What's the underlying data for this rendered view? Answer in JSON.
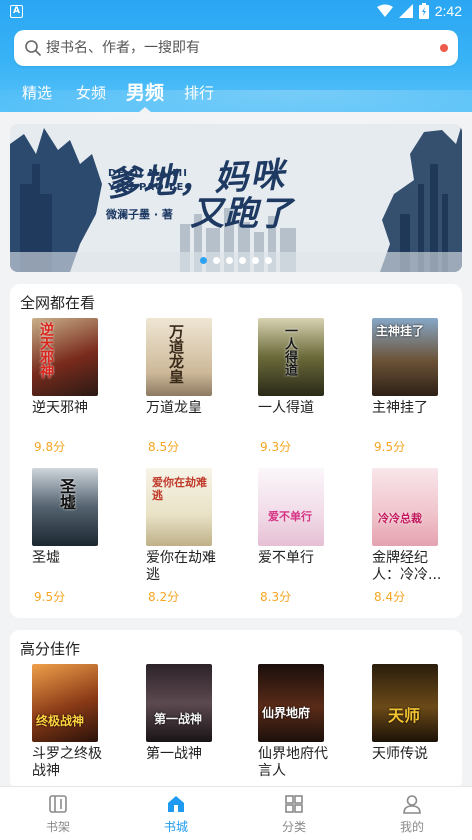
{
  "statusbar": {
    "time": "2:42",
    "app_icon_letter": "A"
  },
  "search": {
    "placeholder": "搜书名、作者，一搜即有"
  },
  "tabs": [
    {
      "label": "精选",
      "active": false
    },
    {
      "label": "女频",
      "active": false
    },
    {
      "label": "男频",
      "active": true
    },
    {
      "label": "排行",
      "active": false
    }
  ],
  "banner": {
    "title_line1": "爹地，妈咪",
    "title_line2": "又跑了",
    "pinyin_line1": "DE DI MA MI",
    "pinyin_line2": "YOU PAO LE",
    "author": "微澜子墨 · 著",
    "dot_count": 6,
    "active_dot": 0
  },
  "sections": [
    {
      "title": "全网都在看",
      "books": [
        {
          "title": "逆天邪神",
          "score": "9.8分",
          "cover_text": "逆天邪神",
          "cover_color": "#7a2b1c"
        },
        {
          "title": "万道龙皇",
          "score": "8.5分",
          "cover_text": "万道龙皇",
          "cover_color": "#d9cbb1"
        },
        {
          "title": "一人得道",
          "score": "9.3分",
          "cover_text": "一人得道",
          "cover_color": "#4b5a2a"
        },
        {
          "title": "主神挂了",
          "score": "9.5分",
          "cover_text": "主神挂了",
          "cover_color": "#5a4630"
        },
        {
          "title": "圣墟",
          "score": "9.5分",
          "cover_text": "圣墟",
          "cover_color": "#2f3d4a"
        },
        {
          "title": "爱你在劫难逃",
          "score": "8.2分",
          "cover_text": "爱你在劫难逃",
          "cover_color": "#f0ede0"
        },
        {
          "title": "爱不单行",
          "score": "8.3分",
          "cover_text": "爱不单行",
          "cover_color": "#f6eef3"
        },
        {
          "title": "金牌经纪人：冷冷...",
          "score": "8.4分",
          "cover_text": "冷冷总裁",
          "cover_color": "#f3d9dc"
        }
      ]
    },
    {
      "title": "高分佳作",
      "books": [
        {
          "title": "斗罗之终极战神",
          "cover_text": "终极战神",
          "cover_color": "#8a3a16"
        },
        {
          "title": "第一战神",
          "cover_text": "第一战神",
          "cover_color": "#3a2f33"
        },
        {
          "title": "仙界地府代言人",
          "cover_text": "仙界地府",
          "cover_color": "#2b1d18"
        },
        {
          "title": "天师传说",
          "cover_text": "天师",
          "cover_color": "#3b2a12"
        }
      ]
    }
  ],
  "bottom_nav": [
    {
      "label": "书架",
      "icon": "bookshelf-icon",
      "active": false
    },
    {
      "label": "书城",
      "icon": "bookstore-icon",
      "active": true
    },
    {
      "label": "分类",
      "icon": "category-icon",
      "active": false
    },
    {
      "label": "我的",
      "icon": "profile-icon",
      "active": false
    }
  ],
  "colors": {
    "accent": "#1e9bf0",
    "score": "#f5a623",
    "header": "#2aa6f3"
  }
}
